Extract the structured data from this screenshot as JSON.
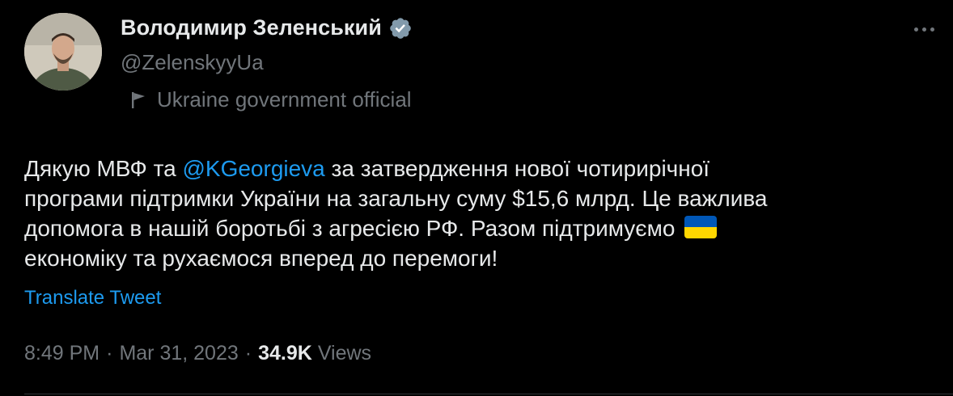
{
  "author": {
    "display_name": "Володимир Зеленський",
    "handle": "@ZelenskyyUa",
    "label": "Ukraine government official"
  },
  "tweet": {
    "line1_pre": "Дякую МВФ та ",
    "mention": "@KGeorgieva",
    "line1_post": " за затвердження нової чотирирічної",
    "line2": "програми підтримки України на загальну суму $15,6 млрд. Це важлива",
    "line3": "допомога в нашій боротьбі з агресією РФ. Разом підтримуємо",
    "line4": "економіку та рухаємося вперед до перемоги!"
  },
  "translate_label": "Translate Tweet",
  "meta": {
    "time": "8:49 PM",
    "separator": "·",
    "date": "Mar 31, 2023",
    "views_count": "34.9K",
    "views_label": "Views"
  },
  "colors": {
    "background": "#000000",
    "link": "#1d9bf0",
    "verified_badge": "#829aab",
    "flag_blue": "#0057b7",
    "flag_yellow": "#ffd700"
  },
  "icons": {
    "verified": "verified-badge-icon",
    "gov_flag": "flag-icon",
    "more": "more-icon",
    "emoji": "ukraine-flag-emoji"
  }
}
